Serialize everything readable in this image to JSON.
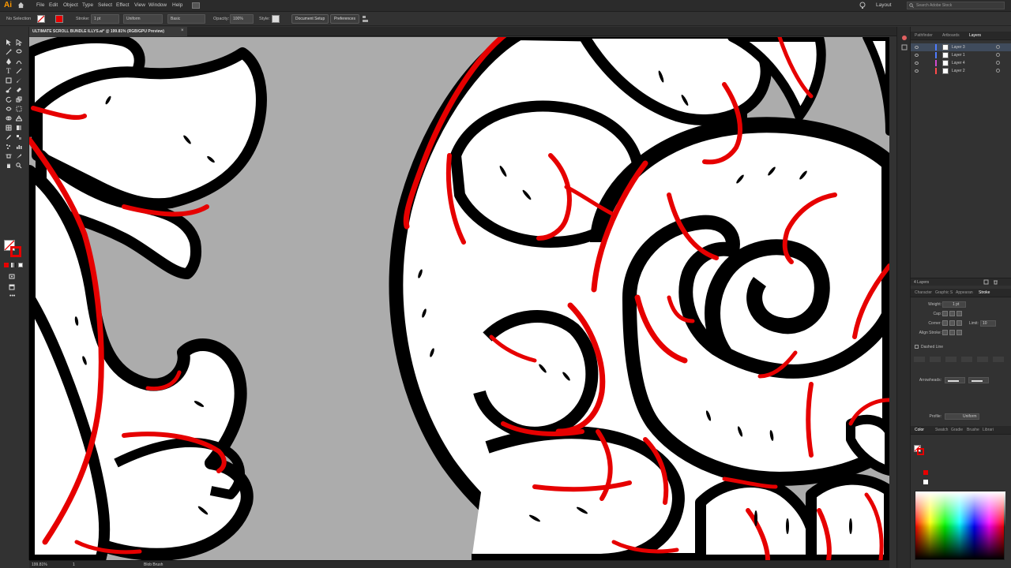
{
  "app": {
    "logo": "Ai"
  },
  "menubar": {
    "items": [
      "File",
      "Edit",
      "Object",
      "Type",
      "Select",
      "Effect",
      "View",
      "Window",
      "Help"
    ],
    "workspace": "Layout",
    "search_placeholder": "Search Adobe Stock"
  },
  "control": {
    "selection_label": "No Selection",
    "stroke_label": "Stroke:",
    "stroke_weight": "1 pt",
    "profile_value": "Uniform",
    "brush_value": "Basic",
    "opacity_label": "Opacity:",
    "opacity_value": "100%",
    "style_label": "Style:",
    "doc_setup": "Document Setup",
    "preferences": "Preferences"
  },
  "document": {
    "tab_title": "ULTIMATE SCROLL BUNDLE ILLYS.ai* @ 199.81% (RGB/GPU Preview)",
    "close": "×"
  },
  "status": {
    "zoom": "199.81%",
    "artboard": "1",
    "tool_name": "Blob Brush"
  },
  "layers_panel": {
    "tabs": [
      "Pathfinder",
      "Artboards",
      "Layers"
    ],
    "active_tab": "Layers",
    "layers": [
      {
        "name": "Layer 3",
        "color": "#4f7bff",
        "selected": true
      },
      {
        "name": "Layer 1",
        "color": "#4f7bff",
        "selected": false
      },
      {
        "name": "Layer 4",
        "color": "#d04ad0",
        "selected": false
      },
      {
        "name": "Layer 2",
        "color": "#ff4a4a",
        "selected": false
      }
    ],
    "count": "4 Layers"
  },
  "stroke_panel": {
    "tabs": [
      "Character",
      "Graphic S",
      "Appearan",
      "Stroke"
    ],
    "active_tab": "Stroke",
    "weight_label": "Weight:",
    "weight_value": "1 pt",
    "cap_label": "Cap:",
    "corner_label": "Corner:",
    "limit_label": "Limit:",
    "limit_value": "10",
    "align_label": "Align Stroke:",
    "dashed_label": "Dashed Line",
    "arrowheads_label": "Arrowheads:",
    "profile_label": "Profile:",
    "profile_value": "Uniform"
  },
  "color_panel": {
    "tabs": [
      "Color",
      "Swatch",
      "Gradie",
      "Brushe",
      "Librari"
    ],
    "active_tab": "Color",
    "stroke_color": "#e60000",
    "fill_color": "#ffffff"
  },
  "colors": {
    "canvas_bg": "#acacac",
    "ink": "#000000",
    "accent_red": "#e60000",
    "paper": "#ffffff"
  }
}
